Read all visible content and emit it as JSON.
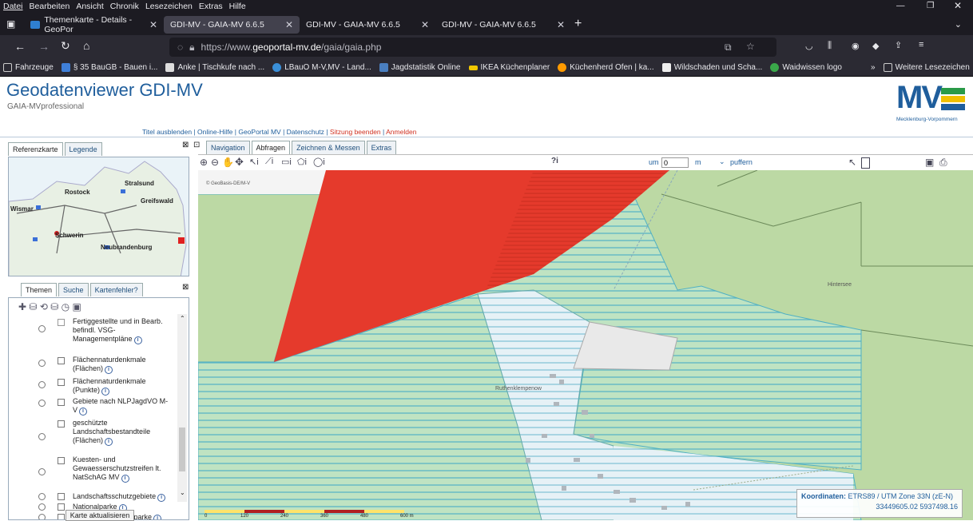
{
  "browser": {
    "menu": [
      "Datei",
      "Bearbeiten",
      "Ansicht",
      "Chronik",
      "Lesezeichen",
      "Extras",
      "Hilfe"
    ],
    "tabs": [
      {
        "label": "Themenkarte - Details - GeoPor"
      },
      {
        "label": "GDI-MV - GAIA-MV 6.6.5"
      },
      {
        "label": "GDI-MV - GAIA-MV 6.6.5"
      },
      {
        "label": "GDI-MV - GAIA-MV 6.6.5"
      }
    ],
    "url_prefix": "https://www.",
    "url_domain": "geoportal-mv.de",
    "url_path": "/gaia/gaia.php",
    "bookmarks": [
      "Fahrzeuge",
      "§ 35 BauGB - Bauen i...",
      "Anke | Tischkufe nach ...",
      "LBauO M-V,MV - Land...",
      "Jagdstatistik Online",
      "IKEA Küchenplaner",
      "Küchenherd Ofen | ka...",
      "Wildschaden und Scha...",
      "Waidwissen logo"
    ],
    "more_bookmarks": "Weitere Lesezeichen"
  },
  "app": {
    "title": "Geodatenviewer GDI-MV",
    "subtitle": "GAIA-MVprofessional",
    "links": [
      "Titel ausblenden",
      "Online-Hilfe",
      "GeoPortal MV",
      "Datenschutz"
    ],
    "links_red": [
      "Sitzung beenden",
      "Anmelden"
    ],
    "logo_text": "MV",
    "logo_sub": "Mecklenburg-Vorpommern"
  },
  "left": {
    "top_tabs": [
      "Referenzkarte",
      "Legende"
    ],
    "refmap_labels": [
      "Stralsund",
      "Rostock",
      "Greifswald",
      "Wismar",
      "Schwerin",
      "Neubrandenburg"
    ],
    "theme_tabs": [
      "Themen",
      "Suche",
      "Kartenfehler?"
    ],
    "layers": [
      {
        "label": "Fertiggestellte und in Bearb. befindl. VSG-Managementpläne"
      },
      {
        "label": "Flächennaturdenkmale (Flächen)"
      },
      {
        "label": "Flächennaturdenkmale (Punkte)"
      },
      {
        "label": "Gebiete nach NLPJagdVO M-V"
      },
      {
        "label": "geschützte Landschaftsbestandteile (Flächen)"
      },
      {
        "label": "Kuesten- und Gewaesserschutzstreifen lt. NatSchAG MV"
      },
      {
        "label": "Landschaftsschutzgebiete"
      },
      {
        "label": "Nationalparke"
      },
      {
        "label": "Zonen der Nationalparke"
      }
    ],
    "refresh_button": "Karte aktualisieren"
  },
  "map": {
    "tabs": [
      "Navigation",
      "Abfragen",
      "Zeichnen & Messen",
      "Extras"
    ],
    "active_tab": "Abfragen",
    "buffer_label": "um",
    "buffer_value": "0",
    "buffer_unit": "m",
    "buffer_action": "puffern",
    "query_icon": "?i",
    "place_labels": [
      "Hintersee",
      "Ruthenklempenow"
    ],
    "copyright": "© GeoBasis-DE/M-V",
    "scale_ticks": [
      "0",
      "120",
      "240",
      "360",
      "480",
      "600 m"
    ],
    "coords_label": "Koordinaten:",
    "coords_system": "ETRS89 / UTM Zone 33N (zE-N)",
    "coords_value": "33449605.02 5937498.16"
  },
  "colors": {
    "accent": "#1f5e9c",
    "red_area": "#e53a2c",
    "green_area": "#bcd9a4",
    "hatch": "#6fc0c8"
  }
}
